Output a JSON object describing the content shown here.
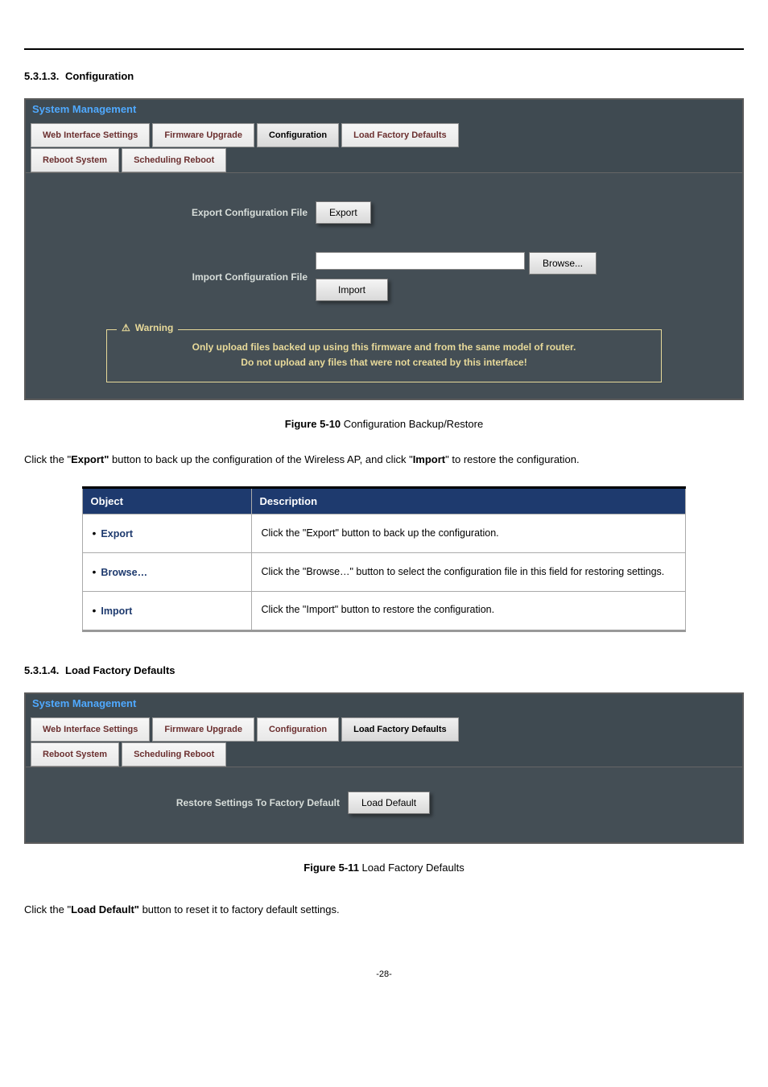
{
  "sections": {
    "config": {
      "number": "5.3.1.3.",
      "title": "Configuration"
    },
    "load_defaults": {
      "number": "5.3.1.4.",
      "title": "Load Factory Defaults"
    }
  },
  "panel1": {
    "title": "System Management",
    "tabs": {
      "web_interface": "Web Interface Settings",
      "firmware": "Firmware Upgrade",
      "configuration": "Configuration",
      "load_defaults": "Load Factory Defaults",
      "reboot": "Reboot System",
      "scheduling": "Scheduling Reboot"
    },
    "export_label": "Export Configuration File",
    "export_btn": "Export",
    "import_label": "Import Configuration File",
    "browse_btn": "Browse...",
    "import_btn": "Import",
    "warning": {
      "legend": "Warning",
      "line1": "Only upload files backed up using this firmware and from the same model of router.",
      "line2": "Do not upload any files that were not created by this interface!"
    }
  },
  "figure1": {
    "num": "Figure 5-10",
    "title": " Configuration Backup/Restore"
  },
  "paragraph1": {
    "p1": "Click the \"",
    "b1": "Export\"",
    "p2": " button to back up the configuration of the Wireless AP, and click \"",
    "b2": "Import",
    "p3": "\" to restore the configuration."
  },
  "table": {
    "headers": {
      "object": "Object",
      "description": "Description"
    },
    "rows": [
      {
        "obj": "Export",
        "desc": "Click the \"Export\" button to back up the configuration."
      },
      {
        "obj": "Browse…",
        "desc": "Click the \"Browse…\" button to select the configuration file in this field for restoring settings."
      },
      {
        "obj": "Import",
        "desc": "Click the \"Import\" button to restore the configuration."
      }
    ]
  },
  "panel2": {
    "title": "System Management",
    "restore_label": "Restore Settings To Factory Default",
    "load_default_btn": "Load Default"
  },
  "figure2": {
    "num": "Figure 5-11",
    "title": " Load Factory Defaults"
  },
  "paragraph2": {
    "p1": "Click the \"",
    "b1": "Load Default\"",
    "p2": " button to reset it to factory default settings."
  },
  "page_num": "-28-"
}
